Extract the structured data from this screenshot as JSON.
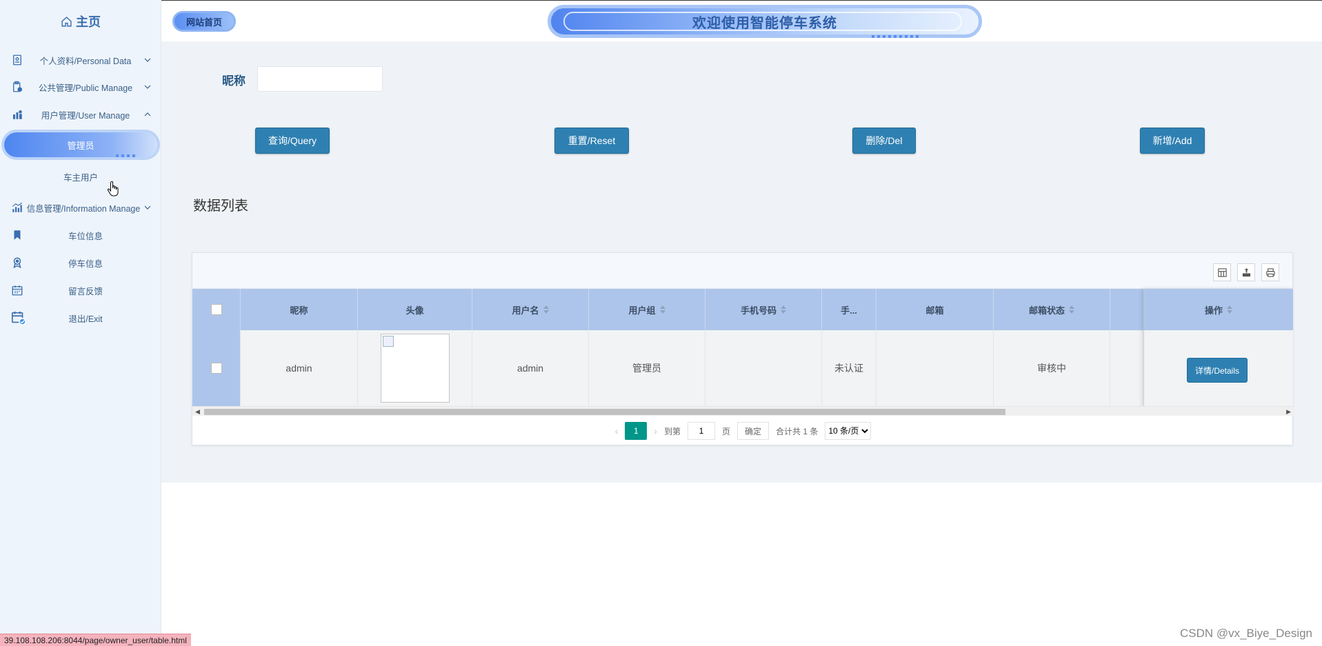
{
  "sidebar": {
    "home_label": "主页",
    "items": [
      {
        "label": "个人资料/Personal Data",
        "icon": "profile-doc-icon"
      },
      {
        "label": "公共管理/Public Manage",
        "icon": "clipboard-icon"
      },
      {
        "label": "用户管理/User Manage",
        "icon": "user-building-icon"
      },
      {
        "label": "信息管理/Information Manage",
        "icon": "chart-icon"
      },
      {
        "label": "车位信息",
        "icon": "bookmark-icon"
      },
      {
        "label": "停车信息",
        "icon": "badge-icon"
      },
      {
        "label": "留言反馈",
        "icon": "calendar-icon"
      },
      {
        "label": "退出/Exit",
        "icon": "calendar-check-icon"
      }
    ],
    "sub_items": [
      "管理员",
      "车主用户"
    ]
  },
  "header": {
    "site_home": "网站首页",
    "banner_title": "欢迎使用智能停车系统"
  },
  "search": {
    "label": "昵称",
    "value": ""
  },
  "actions": {
    "query": "查询/Query",
    "reset": "重置/Reset",
    "delete": "删除/Del",
    "add": "新增/Add"
  },
  "section_title": "数据列表",
  "table": {
    "columns": [
      "昵称",
      "头像",
      "用户名",
      "用户组",
      "手机号码",
      "手...",
      "邮箱",
      "邮箱状态",
      "",
      "操作"
    ],
    "rows": [
      {
        "nickname": "admin",
        "username": "admin",
        "group": "管理员",
        "phone": "",
        "truncated": "未认证",
        "email": "",
        "email_status": "审核中",
        "detail_button": "详情/Details"
      }
    ]
  },
  "pagination": {
    "current_page": "1",
    "goto_label": "到第",
    "goto_value": "1",
    "page_unit": "页",
    "confirm": "确定",
    "total": "合计共 1 条",
    "page_size": "10 条/页"
  },
  "status_bar_url": "39.108.108.206:8044/page/owner_user/table.html",
  "watermark": "CSDN @vx_Biye_Design",
  "colors": {
    "accent": "#2f80b2",
    "header_row": "#aec5eb",
    "current_page": "#009688",
    "sidebar_bg": "#eef4fb"
  }
}
